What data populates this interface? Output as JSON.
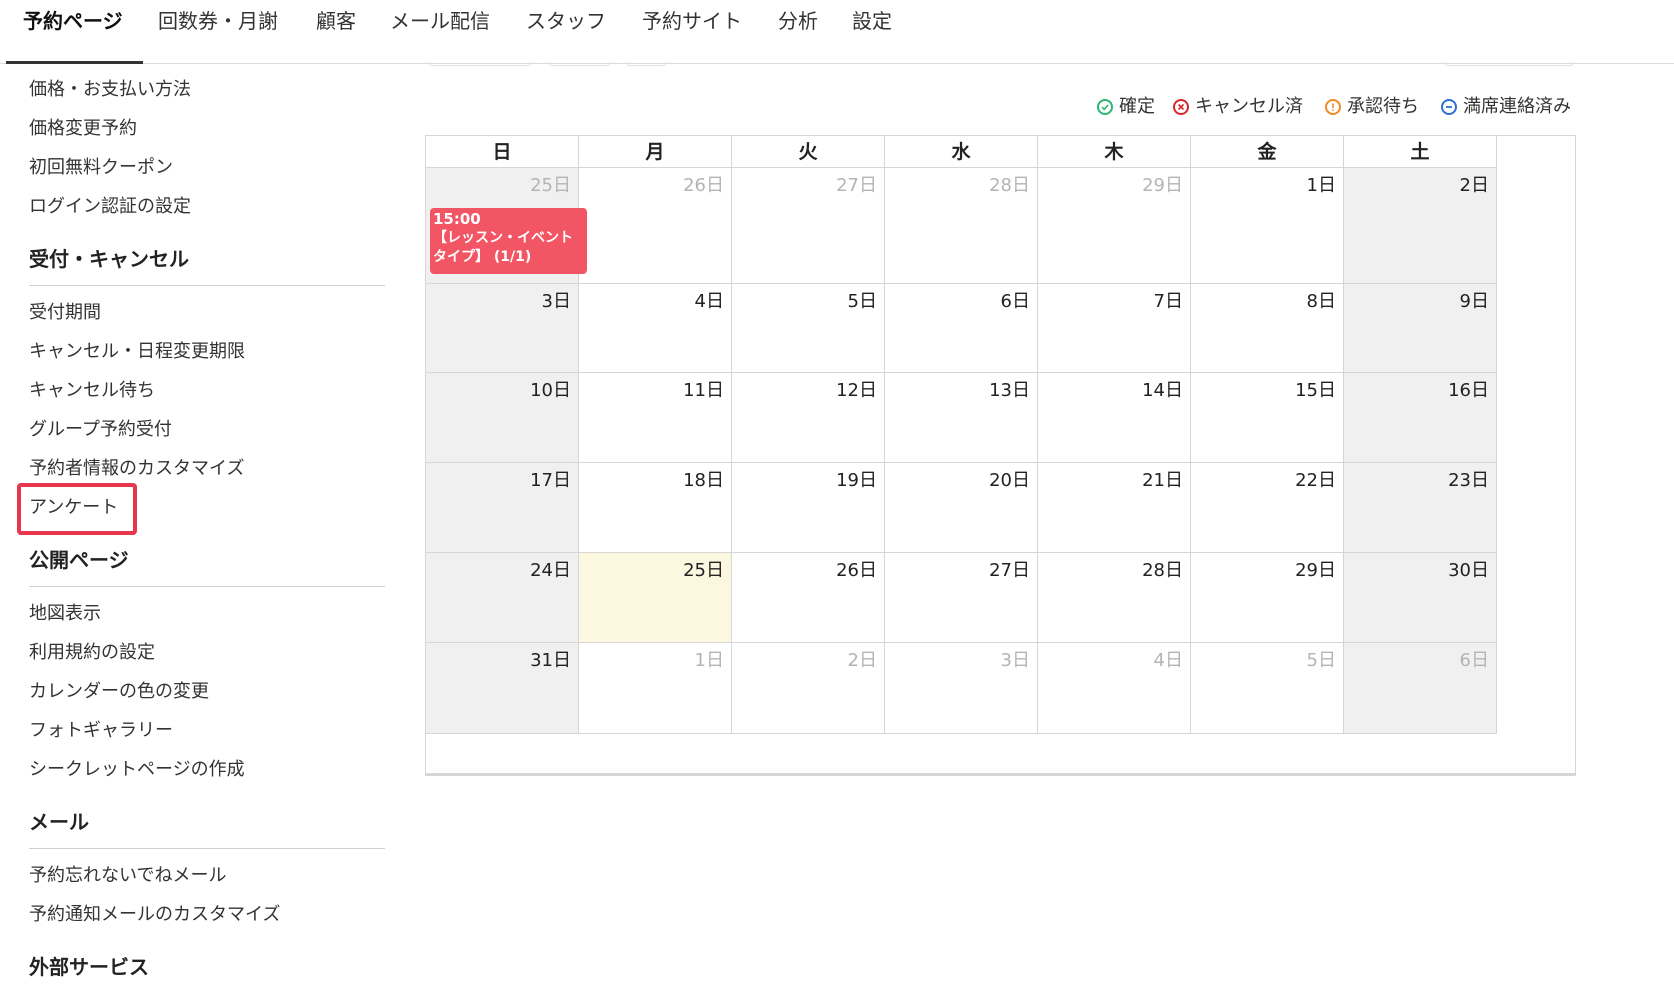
{
  "nav": {
    "tabs": [
      {
        "label": "予約ページ",
        "active": true
      },
      {
        "label": "回数券・月謝"
      },
      {
        "label": "顧客"
      },
      {
        "label": "メール配信"
      },
      {
        "label": "スタッフ"
      },
      {
        "label": "予約サイト"
      },
      {
        "label": "分析"
      },
      {
        "label": "設定"
      }
    ]
  },
  "sidebar": {
    "top_items": [
      "価格・お支払い方法",
      "価格変更予約",
      "初回無料クーポン",
      "ログイン認証の設定"
    ],
    "sections": [
      {
        "heading": "受付・キャンセル",
        "items": [
          "受付期間",
          "キャンセル・日程変更期限",
          "キャンセル待ち",
          "グループ予約受付",
          "予約者情報のカスタマイズ",
          "アンケート"
        ]
      },
      {
        "heading": "公開ページ",
        "items": [
          "地図表示",
          "利用規約の設定",
          "カレンダーの色の変更",
          "フォトギャラリー",
          "シークレットページの作成"
        ]
      },
      {
        "heading": "メール",
        "items": [
          "予約忘れないでねメール",
          "予約通知メールのカスタマイズ"
        ]
      },
      {
        "heading": "外部サービス",
        "items": []
      }
    ]
  },
  "legend": [
    {
      "label": "確定",
      "color": "#2bb673",
      "icon": "check-circle-icon"
    },
    {
      "label": "キャンセル済",
      "color": "#d9262e",
      "icon": "x-circle-icon"
    },
    {
      "label": "承認待ち",
      "color": "#f08a24",
      "icon": "exclamation-circle-icon"
    },
    {
      "label": "満席連絡済み",
      "color": "#2c6ed5",
      "icon": "minus-circle-icon"
    }
  ],
  "calendar": {
    "weekdays": [
      "日",
      "月",
      "火",
      "水",
      "木",
      "金",
      "土"
    ],
    "weeks": [
      [
        {
          "day": "25日",
          "other": true
        },
        {
          "day": "26日",
          "other": true
        },
        {
          "day": "27日",
          "other": true
        },
        {
          "day": "28日",
          "other": true
        },
        {
          "day": "29日",
          "other": true
        },
        {
          "day": "1日"
        },
        {
          "day": "2日"
        }
      ],
      [
        {
          "day": "3日"
        },
        {
          "day": "4日"
        },
        {
          "day": "5日"
        },
        {
          "day": "6日"
        },
        {
          "day": "7日"
        },
        {
          "day": "8日"
        },
        {
          "day": "9日"
        }
      ],
      [
        {
          "day": "10日"
        },
        {
          "day": "11日"
        },
        {
          "day": "12日"
        },
        {
          "day": "13日"
        },
        {
          "day": "14日"
        },
        {
          "day": "15日"
        },
        {
          "day": "16日"
        }
      ],
      [
        {
          "day": "17日"
        },
        {
          "day": "18日"
        },
        {
          "day": "19日"
        },
        {
          "day": "20日"
        },
        {
          "day": "21日"
        },
        {
          "day": "22日"
        },
        {
          "day": "23日"
        }
      ],
      [
        {
          "day": "24日"
        },
        {
          "day": "25日",
          "today": true
        },
        {
          "day": "26日"
        },
        {
          "day": "27日"
        },
        {
          "day": "28日"
        },
        {
          "day": "29日"
        },
        {
          "day": "30日"
        }
      ],
      [
        {
          "day": "31日"
        },
        {
          "day": "1日",
          "other": true
        },
        {
          "day": "2日",
          "other": true
        },
        {
          "day": "3日",
          "other": true
        },
        {
          "day": "4日",
          "other": true
        },
        {
          "day": "5日",
          "other": true
        },
        {
          "day": "6日",
          "other": true
        }
      ]
    ],
    "events": [
      {
        "week": 0,
        "weekday": 0,
        "time": "15:00",
        "title": "【レッスン・イベントタイプ】 (1/1)",
        "color": "#f25563"
      }
    ]
  }
}
